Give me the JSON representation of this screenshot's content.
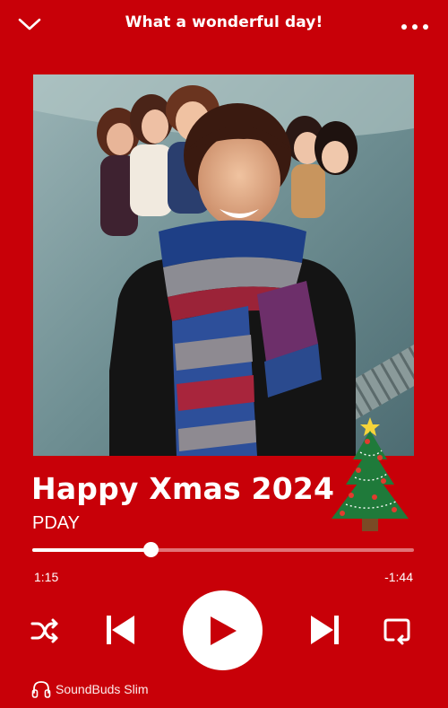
{
  "header": {
    "title": "What a wonderful day!",
    "collapse_icon": "chevron-down-icon",
    "more_icon": "more-horizontal-icon"
  },
  "album_art": {
    "description_icon": "album-cover-photo"
  },
  "track": {
    "title": "Happy Xmas 2024",
    "artist": "PDAY"
  },
  "decoration": {
    "icon": "christmas-tree-icon"
  },
  "playback": {
    "elapsed": "1:15",
    "remaining": "-1:44",
    "progress_fraction": 0.31
  },
  "controls": {
    "shuffle_icon": "shuffle-icon",
    "previous_icon": "skip-previous-icon",
    "play_icon": "play-icon",
    "next_icon": "skip-next-icon",
    "repeat_icon": "repeat-icon"
  },
  "device": {
    "icon": "headphones-icon",
    "name": "SoundBuds Slim"
  },
  "colors": {
    "background": "#c80008",
    "foreground": "#ffffff"
  }
}
